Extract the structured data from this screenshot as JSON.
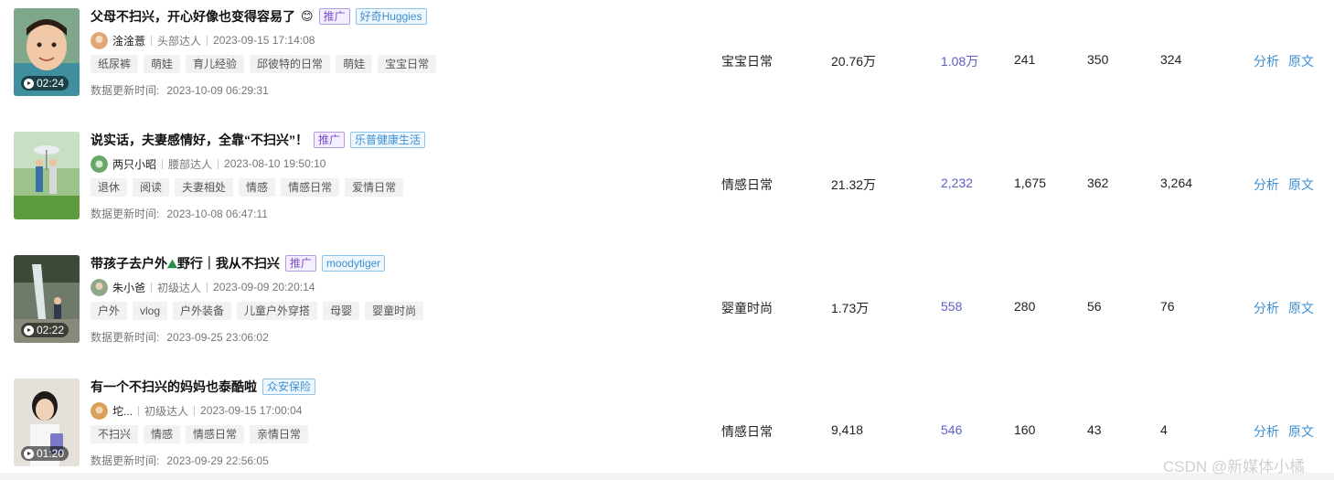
{
  "rows": [
    {
      "title": "父母不扫兴，开心好像也变得容易了",
      "emoji": "😊",
      "promo": "推广",
      "brand": "好奇Huggies",
      "duration": "02:24",
      "author": "淦淦薏",
      "level": "头部达人",
      "publish_time": "2023-09-15 17:14:08",
      "tags": [
        "纸尿裤",
        "萌娃",
        "育儿经验",
        "邱彼特的日常",
        "萌娃",
        "宝宝日常"
      ],
      "update_label": "数据更新时间:",
      "update_time": "2023-10-09 06:29:31",
      "category": "宝宝日常",
      "plays": "20.76万",
      "likes": "1.08万",
      "collects": "241",
      "comments": "350",
      "shares": "324",
      "analyze": "分析",
      "original": "原文"
    },
    {
      "title": "说实话，夫妻感情好，全靠“不扫兴”！",
      "emoji": "",
      "promo": "推广",
      "brand": "乐普健康生活",
      "duration": "",
      "author": "两只小昭",
      "level": "腰部达人",
      "publish_time": "2023-08-10 19:50:10",
      "tags": [
        "退休",
        "阅读",
        "夫妻相处",
        "情感",
        "情感日常",
        "爱情日常"
      ],
      "update_label": "数据更新时间:",
      "update_time": "2023-10-08 06:47:11",
      "category": "情感日常",
      "plays": "21.32万",
      "likes": "2,232",
      "collects": "1,675",
      "comments": "362",
      "shares": "3,264",
      "analyze": "分析",
      "original": "原文"
    },
    {
      "title": "带孩子去户外",
      "emoji": "⛰",
      "title_tail": "野行｜我从不扫兴",
      "promo": "推广",
      "brand": "moodytiger",
      "duration": "02:22",
      "author": "朱小爸",
      "level": "初级达人",
      "publish_time": "2023-09-09 20:20:14",
      "tags": [
        "户外",
        "vlog",
        "户外装备",
        "儿童户外穿搭",
        "母婴",
        "婴童时尚"
      ],
      "update_label": "数据更新时间:",
      "update_time": "2023-09-25 23:06:02",
      "category": "婴童时尚",
      "plays": "1.73万",
      "likes": "558",
      "collects": "280",
      "comments": "56",
      "shares": "76",
      "analyze": "分析",
      "original": "原文"
    },
    {
      "title": "有一个不扫兴的妈妈也泰酷啦",
      "emoji": "",
      "promo": "",
      "brand": "众安保险",
      "duration": "01:20",
      "author": "坨...",
      "level": "初级达人",
      "publish_time": "2023-09-15 17:00:04",
      "tags": [
        "不扫兴",
        "情感",
        "情感日常",
        "亲情日常"
      ],
      "update_label": "数据更新时间:",
      "update_time": "2023-09-29 22:56:05",
      "category": "情感日常",
      "plays": "9,418",
      "likes": "546",
      "collects": "160",
      "comments": "43",
      "shares": "4",
      "analyze": "分析",
      "original": "原文"
    }
  ],
  "watermark": "CSDN @新媒体小橘",
  "colors": {
    "accent": "#3f8fd0",
    "likes": "#5b5fc7",
    "promo": "#7c4dcc"
  }
}
